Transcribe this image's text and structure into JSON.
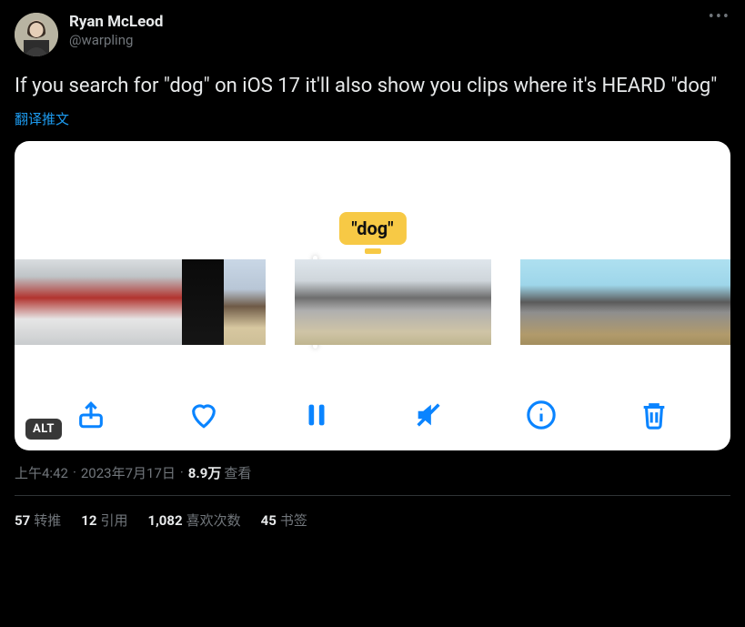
{
  "user": {
    "display_name": "Ryan McLeod",
    "handle": "@warpling"
  },
  "tweet": {
    "text": "If you search for \"dog\" on iOS 17 it'll also show you clips where it's HEARD \"dog\"",
    "translate_label": "翻译推文",
    "tooltip_text": "\"dog\"",
    "alt_badge": "ALT"
  },
  "meta": {
    "time": "上午4:42",
    "date": "2023年7月17日",
    "views_count": "8.9万",
    "views_suffix": "查看"
  },
  "stats": {
    "retweets_count": "57",
    "retweets_label": "转推",
    "quotes_count": "12",
    "quotes_label": "引用",
    "likes_count": "1,082",
    "likes_label": "喜欢次数",
    "bookmarks_count": "45",
    "bookmarks_label": "书签"
  },
  "toolbar": {
    "share": "share",
    "like": "like",
    "pause": "pause",
    "mute": "mute",
    "info": "info",
    "delete": "delete"
  }
}
